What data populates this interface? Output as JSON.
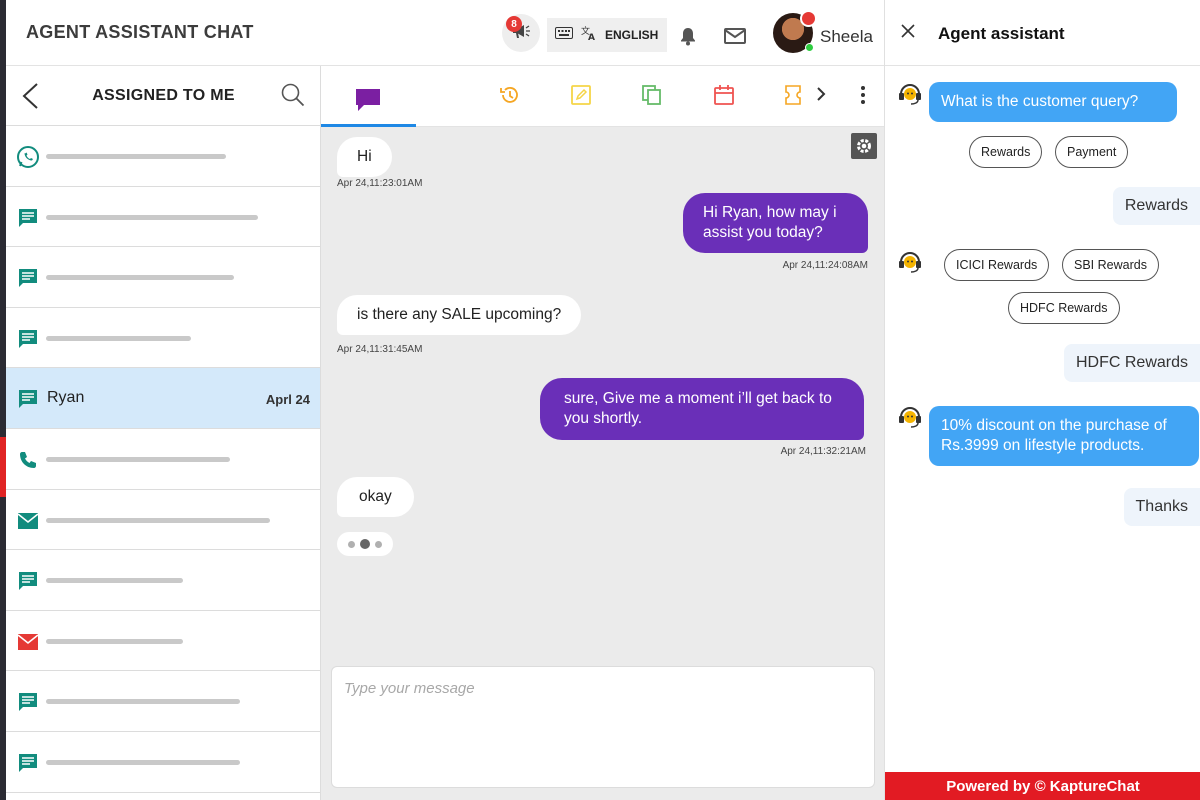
{
  "app": {
    "title": "AGENT ASSISTANT CHAT"
  },
  "header": {
    "notification_count": "8",
    "language": "ENGLISH",
    "user_name": "Sheela"
  },
  "sidebar": {
    "title": "ASSIGNED TO ME",
    "conversations": [
      {
        "channel": "whatsapp-icon",
        "name": "",
        "date": "",
        "color": "#128c7e"
      },
      {
        "channel": "chat-icon",
        "name": "",
        "date": "",
        "color": "#128c7e"
      },
      {
        "channel": "chat-icon",
        "name": "",
        "date": "",
        "color": "#128c7e"
      },
      {
        "channel": "chat-icon",
        "name": "",
        "date": "",
        "color": "#128c7e"
      },
      {
        "channel": "chat-icon",
        "name": "Ryan",
        "date": "Aprl 24",
        "color": "#128c7e",
        "active": true
      },
      {
        "channel": "phone-icon",
        "name": "",
        "date": "",
        "color": "#128c7e"
      },
      {
        "channel": "mail-icon",
        "name": "",
        "date": "",
        "color": "#128c7e"
      },
      {
        "channel": "chat-icon",
        "name": "",
        "date": "",
        "color": "#128c7e"
      },
      {
        "channel": "mail-icon",
        "name": "",
        "date": "",
        "color": "#e53935"
      },
      {
        "channel": "chat-icon",
        "name": "",
        "date": "",
        "color": "#128c7e"
      },
      {
        "channel": "chat-icon",
        "name": "",
        "date": "",
        "color": "#128c7e"
      }
    ]
  },
  "chat": {
    "messages": [
      {
        "side": "in",
        "text": "Hi",
        "time": "Apr 24,11:23:01AM"
      },
      {
        "side": "out",
        "text": "Hi Ryan, how may i assist you today?",
        "time": "Apr 24,11:24:08AM"
      },
      {
        "side": "in",
        "text": "is there any SALE upcoming?",
        "time": "Apr 24,11:31:45AM"
      },
      {
        "side": "out",
        "text": "sure, Give me a moment i’ll get back to you shortly.",
        "time": "Apr 24,11:32:21AM"
      },
      {
        "side": "in",
        "text": "okay",
        "time": ""
      }
    ],
    "composer_placeholder": "Type your message"
  },
  "assistant": {
    "title": "Agent assistant",
    "q1": "What is the customer query?",
    "chips1": [
      "Rewards",
      "Payment"
    ],
    "user1": "Rewards",
    "chips2": [
      "ICICI Rewards",
      "SBI Rewards",
      "HDFC Rewards"
    ],
    "user2": "HDFC Rewards",
    "answer": "10% discount on the purchase of Rs.3999 on lifestyle products.",
    "user3": "Thanks",
    "footer": "Powered by © KaptureChat"
  },
  "colors": {
    "accent_purple": "#6a2fb8",
    "assistant_blue": "#42a5f5",
    "active_row": "#d4e9fa",
    "footer_red": "#e21b23"
  }
}
